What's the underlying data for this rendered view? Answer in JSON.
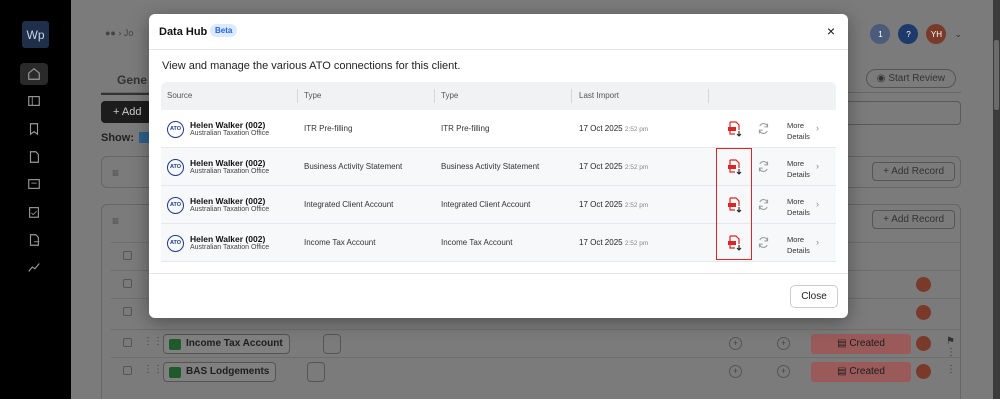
{
  "sidebar": {
    "logo": "Wp",
    "icons": [
      "home-icon",
      "table-icon",
      "bookmark-icon",
      "document-icon",
      "card-icon",
      "clipboard-icon",
      "export-icon",
      "chart-icon"
    ]
  },
  "background": {
    "breadcrumb": "Jo",
    "tab_label": "Gene",
    "start_review": "Start Review",
    "add_label": "+ Add",
    "show_label": "Show:",
    "add_record_1": "+ Add Record",
    "add_record_2": "+ Add Record",
    "user_initials": "YH",
    "notification_count": "1",
    "rows": [
      {
        "label": "Income Tax Account",
        "status": "Created"
      },
      {
        "label": "BAS Lodgements",
        "status": "Created"
      }
    ]
  },
  "modal": {
    "title": "Data Hub",
    "badge": "Beta",
    "intro": "View and manage the various ATO connections for this client.",
    "columns": [
      "Source",
      "Type",
      "Type",
      "Last Import"
    ],
    "rows": [
      {
        "name": "Helen Walker (002)",
        "org": "Australian Taxation Office",
        "type1": "ITR Pre-filling",
        "type2": "ITR Pre-filling",
        "date": "17 Oct 2025",
        "time": "2:52 pm",
        "more": "More",
        "details": "Details"
      },
      {
        "name": "Helen Walker (002)",
        "org": "Australian Taxation Office",
        "type1": "Business Activity Statement",
        "type2": "Business Activity Statement",
        "date": "17 Oct 2025",
        "time": "2:52 pm",
        "more": "More",
        "details": "Details"
      },
      {
        "name": "Helen Walker (002)",
        "org": "Australian Taxation Office",
        "type1": "Integrated Client Account",
        "type2": "Integrated Client Account",
        "date": "17 Oct 2025",
        "time": "2:52 pm",
        "more": "More",
        "details": "Details"
      },
      {
        "name": "Helen Walker (002)",
        "org": "Australian Taxation Office",
        "type1": "Income Tax Account",
        "type2": "Income Tax Account",
        "date": "17 Oct 2025",
        "time": "2:52 pm",
        "more": "More",
        "details": "Details"
      }
    ],
    "ato_badge": "ATO",
    "close_button": "Close",
    "close_icon": "×",
    "highlight_color": "#dc2626"
  }
}
